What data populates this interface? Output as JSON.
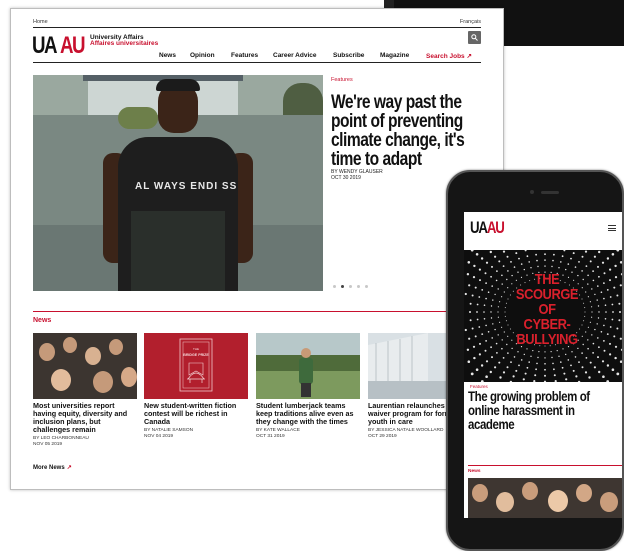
{
  "utility": {
    "home": "Home",
    "language": "Français"
  },
  "brand": {
    "logo_left": "UA",
    "logo_right": "AU",
    "name_en": "University Affairs",
    "name_fr": "Affaires universitaires",
    "colors": {
      "accent": "#c8102e",
      "text": "#111111"
    }
  },
  "nav": {
    "items": [
      "News",
      "Opinion",
      "Features",
      "Career Advice",
      "Subscribe",
      "Magazine",
      "Search Jobs ↗"
    ],
    "search_icon": "search-icon"
  },
  "hero": {
    "category": "Features",
    "title": "We're way past the point of preventing climate change, it's time to adapt",
    "byline": "BY WENDY GLAUSER",
    "date": "OCT 30 2019",
    "shirt_text": "AL WAYS ENDI SS",
    "carousel": {
      "count": 5,
      "active_index": 1
    }
  },
  "news": {
    "label": "News",
    "more": "More News",
    "items": [
      {
        "title_lines": [
          "Most universities report",
          "having equity, diversity and",
          "inclusion plans, but",
          "challenges remain"
        ],
        "byline": "BY LEO CHARBONNEAU",
        "date": "NOV 05 2019"
      },
      {
        "title_lines": [
          "New student-written fiction",
          "contest will be richest in",
          "Canada"
        ],
        "byline": "BY NATALIE SAMSON",
        "date": "NOV 04 2019",
        "thumb_text_top": "THE",
        "thumb_text_main": "BRIDGE PRIZE"
      },
      {
        "title_lines": [
          "Student lumberjack teams",
          "keep traditions alive even as",
          "they change with the times"
        ],
        "byline": "BY KATE WALLACE",
        "date": "OCT 31 2019"
      },
      {
        "title_lines": [
          "Laurentian relaunches tu",
          "waiver program for form",
          "youth in care"
        ],
        "byline": "BY JESSICA NATALE WOOLLARD",
        "date": "OCT 29 2019"
      }
    ]
  },
  "mobile": {
    "logo_left": "UA",
    "logo_right": "AU",
    "hero_headline_lines": [
      "THE",
      "SCOURGE",
      "OF",
      "CYBER-",
      "BULLYING"
    ],
    "category": "Features",
    "title": "The growing problem of online harassment in academe",
    "news_label": "News"
  }
}
